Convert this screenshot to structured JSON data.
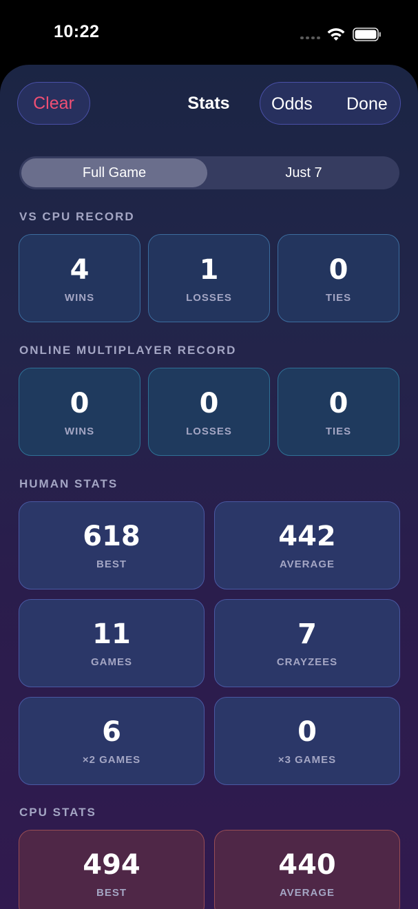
{
  "status_bar": {
    "time": "10:22"
  },
  "header": {
    "clear_label": "Clear",
    "title": "Stats",
    "odds_label": "Odds",
    "done_label": "Done"
  },
  "segmented": {
    "options": [
      "Full Game",
      "Just 7"
    ],
    "selected": "Full Game"
  },
  "vs_cpu": {
    "title": "VS CPU RECORD",
    "cards": [
      {
        "value": "4",
        "label": "WINS"
      },
      {
        "value": "1",
        "label": "LOSSES"
      },
      {
        "value": "0",
        "label": "TIES"
      }
    ]
  },
  "online": {
    "title": "ONLINE MULTIPLAYER RECORD",
    "cards": [
      {
        "value": "0",
        "label": "WINS"
      },
      {
        "value": "0",
        "label": "LOSSES"
      },
      {
        "value": "0",
        "label": "TIES"
      }
    ]
  },
  "human_stats": {
    "title": "HUMAN STATS",
    "cards": [
      {
        "value": "618",
        "label": "BEST"
      },
      {
        "value": "442",
        "label": "AVERAGE"
      },
      {
        "value": "11",
        "label": "GAMES"
      },
      {
        "value": "7",
        "label": "CRAYZEES"
      },
      {
        "value": "6",
        "label": "×2 GAMES"
      },
      {
        "value": "0",
        "label": "×3 GAMES"
      }
    ]
  },
  "cpu_stats": {
    "title": "CPU STATS",
    "cards": [
      {
        "value": "494",
        "label": "BEST"
      },
      {
        "value": "440",
        "label": "AVERAGE"
      }
    ]
  },
  "colors": {
    "clear": "#ef4f74",
    "section_header": "#a4a6c4"
  }
}
